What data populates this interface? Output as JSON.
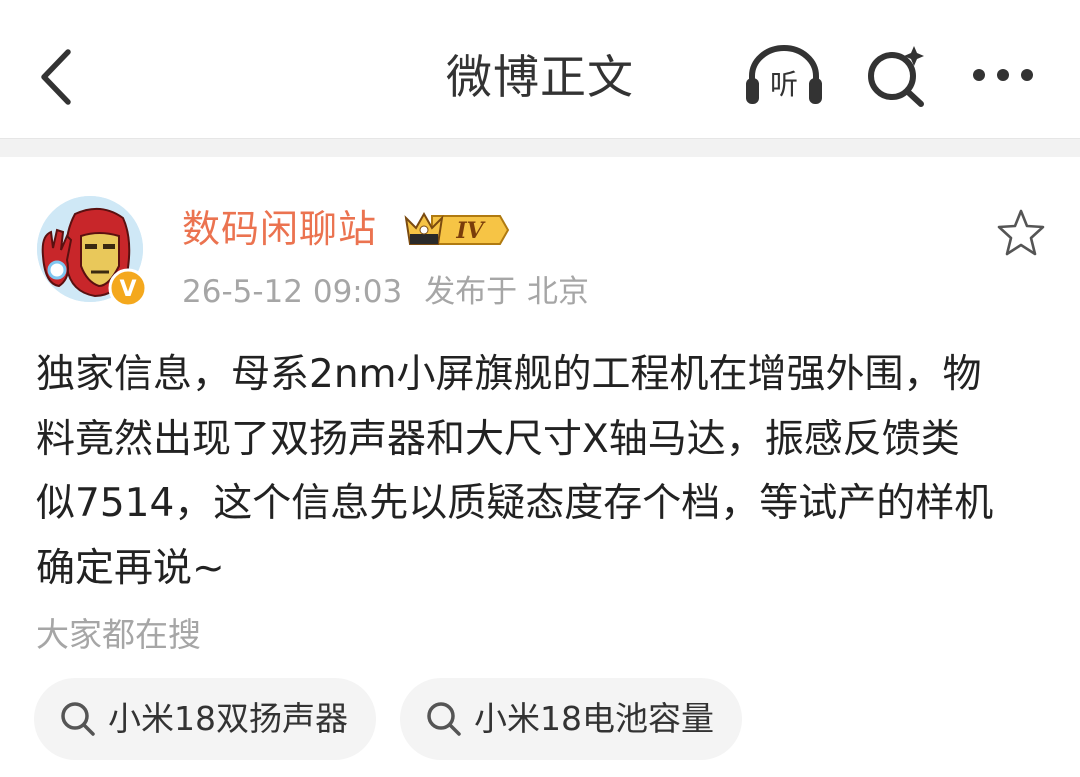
{
  "header": {
    "title": "微博正文",
    "back_icon": "back-arrow-icon",
    "listen_label": "听",
    "search_icon": "search-icon",
    "more_icon": "more-dots-icon"
  },
  "post": {
    "author": "数码闲聊站",
    "level_badge": "IV",
    "verified_mark": "V",
    "timestamp": "26-5-12 09:03",
    "location": "发布于 北京",
    "favorite_icon": "star-outline-icon",
    "lines": [
      "独家信息，母系2nm小屏旗舰的工程机在增强外围，物",
      "料竟然出现了双扬声器和大尺寸X轴马达，振感反馈类",
      "似7514，这个信息先以质疑态度存个档，等试产的样机",
      "确定再说~"
    ]
  },
  "hot_search": {
    "header": "大家都在搜",
    "chips": [
      "小米18双扬声器",
      "小米18电池容量"
    ]
  },
  "colors": {
    "author": "#eb7350",
    "meta": "#a6a6a6",
    "text": "#222222",
    "divider": "#f2f2f2",
    "chip_bg": "#f4f4f4",
    "badge_gold": "#f6c445"
  }
}
